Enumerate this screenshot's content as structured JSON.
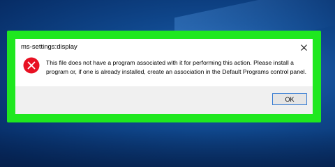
{
  "dialog": {
    "title": "ms-settings:display",
    "message": "This file does not have a program associated with it for performing this action. Please install a program or, if one is already installed, create an association in the Default Programs control panel.",
    "ok_label": "OK",
    "icon": "error-icon",
    "close_icon": "close-icon"
  },
  "colors": {
    "highlight_frame": "#1fe81f",
    "error_red": "#e81123",
    "ok_border": "#3c7fd3",
    "button_bar": "#f0f0f0",
    "desktop_blue": "#10498f"
  }
}
